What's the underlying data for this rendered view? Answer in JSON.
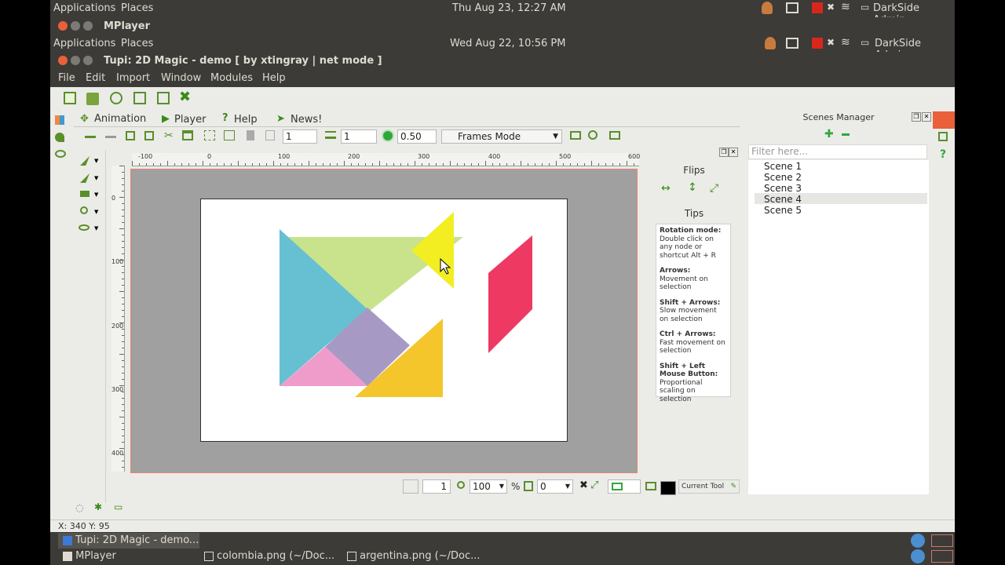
{
  "top_panel": {
    "applications": "Applications",
    "places": "Places",
    "clock": "Thu Aug 23, 12:27 AM",
    "user": "DarkSide Admin"
  },
  "outer_window": {
    "title": "MPlayer"
  },
  "inner_panel": {
    "applications": "Applications",
    "places": "Places",
    "clock": "Wed Aug 22, 10:56 PM",
    "user": "DarkSide Admin"
  },
  "tupi_window": {
    "title": "Tupi: 2D Magic - demo [ by xtingray | net mode ]"
  },
  "menu": [
    "File",
    "Edit",
    "Import",
    "Window",
    "Modules",
    "Help"
  ],
  "tabs": {
    "animation": "Animation",
    "player": "Player",
    "help": "Help",
    "news": "News!"
  },
  "toolbar": {
    "frame_value": "1",
    "layer_value": "1",
    "opacity_value": "0.50",
    "mode": "Frames Mode"
  },
  "ruler": {
    "h_labels": [
      "-100",
      "0",
      "100",
      "200",
      "300",
      "400",
      "500",
      "600"
    ],
    "v_labels": [
      "0",
      "100",
      "200",
      "300",
      "400"
    ]
  },
  "flips": {
    "title": "Flips"
  },
  "tips": {
    "title": "Tips",
    "items": [
      {
        "head": "Rotation mode:",
        "body": " Double click on any node or shortcut Alt + R"
      },
      {
        "head": "Arrows:",
        "body": " Movement on selection"
      },
      {
        "head": "Shift + Arrows:",
        "body": " Slow movement on selection"
      },
      {
        "head": "Ctrl + Arrows:",
        "body": " Fast movement on selection"
      },
      {
        "head": "Shift + Left Mouse Button:",
        "body": " Proportional scaling on selection"
      }
    ]
  },
  "scenes_manager": {
    "title": "Scenes Manager",
    "filter_placeholder": "Filter here...",
    "scenes": [
      "Scene 1",
      "Scene 2",
      "Scene 3",
      "Scene 4",
      "Scene 5"
    ],
    "selected_index": 3
  },
  "bottom": {
    "page_value": "1",
    "zoom_value": "100",
    "zoom_unit": "%",
    "rotation_value": "0",
    "current_tool": "Current Tool"
  },
  "status": {
    "coords": "X: 340 Y: 95"
  },
  "taskbar": {
    "items": [
      "Tupi: 2D Magic - demo...",
      "colombia.png (~/Doc...",
      "argentina.png (~/Doc...",
      "MPlayer"
    ]
  },
  "colors": {
    "teal": "#67c0d1",
    "lime": "#c8e38c",
    "yellow": "#f2ee21",
    "red": "#ee3962",
    "purple": "#a69ac4",
    "pink": "#f09ccb",
    "orange": "#f4c62c",
    "accent": "#e9603a"
  }
}
